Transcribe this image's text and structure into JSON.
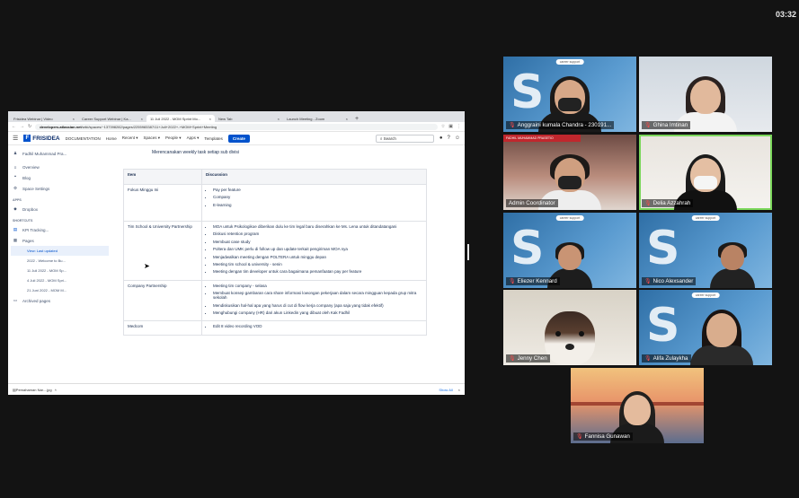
{
  "clock": "03:32",
  "browser": {
    "tabs": [
      {
        "title": "Frisidea Webinar | Video",
        "active": false
      },
      {
        "title": "Career Support Webinar | Ka...",
        "active": false
      },
      {
        "title": "11 Juli 2022 - MOM Sprint Mo...",
        "active": true
      },
      {
        "title": "New Tab",
        "active": false
      },
      {
        "title": "Launch Meeting - Zoom",
        "active": false
      }
    ],
    "url_host": "developers.atlassian.net",
    "url_path": "/wiki/spaces/~137398282/pages/2255983387/11+Juli+2022+-+MOM+Sprint+Meeting"
  },
  "confluence": {
    "logo": "FRISIDEA",
    "doc_label": "DOCUMENTATION",
    "nav": [
      "Home",
      "Recent ▾",
      "Spaces ▾",
      "People ▾",
      "Apps ▾",
      "Templates"
    ],
    "create_label": "Create",
    "search_placeholder": "Search"
  },
  "sidebar": {
    "user": "Fadhil Muhammad Pra...",
    "items": [
      "Overview",
      "Blog",
      "Space Settings"
    ],
    "apps_header": "APPS",
    "apps": [
      "Dropbox"
    ],
    "shortcuts_header": "SHORTCUTS",
    "shortcuts": [
      "KPI Tracking..."
    ],
    "pages_label": "Pages",
    "pages": [
      {
        "label": "View: Last updated",
        "highlight": true
      },
      {
        "label": "2022 - Welcome to Bu...",
        "highlight": false
      },
      {
        "label": "11 Juli 2022 - MOM Sp...",
        "highlight": false
      },
      {
        "label": "4 Juli 2022 - MOM Spri...",
        "highlight": false
      },
      {
        "label": "21 Juni 2022 - MOM M...",
        "highlight": false
      }
    ],
    "archived": "Archived pages"
  },
  "page": {
    "intro": "Merencanakan weekly task setiap sub divisi",
    "table_headers": [
      "Item",
      "Discussion"
    ],
    "rows": [
      {
        "item": "Fokus Minggu Ini",
        "points": [
          "Pay per feature",
          "Company",
          "E-learning"
        ]
      },
      {
        "item": "Tim School & University Partnership",
        "points": [
          "MOA untuk Psikologikoe diberikan dulu ke tim legal baru diserahkan ke Ms. Lena untuk ditandatangani",
          "Diskusi retention program",
          "Membuat case study",
          "Poltera dan UMK perlu di follow up dan update terkait pengiriman MOA nya",
          "Menjadwalkan meeting dengan POLTERA untuk minggu depan",
          "Meeting tim school & university - senin",
          "Meeting dengan tim developer untuk cara bagaimana pemanfaatan pay per feature"
        ]
      },
      {
        "item": "Company Partnership",
        "points": [
          "Meeting tim company - selasa",
          "Membuat konsep gambaran cara share informasi lowongan pekerjaan dalam secara mingguan kepada grup mitra sekolah",
          "Mendiskusikan hal-hal apa yang harus di cut di flow kerja company (apa saja yang tidak efektif)",
          "Menghubungi company (HR) dari akun Linkedin yang dibuat oleh Kak Fadhil"
        ]
      },
      {
        "item": "Medcom",
        "points": [
          "Edit 8 video recording VOD"
        ]
      }
    ]
  },
  "download_bar": {
    "file": "Pemahaman Nar....jpg",
    "show_all": "Show All"
  },
  "participants": [
    {
      "name": "Anggraini kumala Chandra - 230191...",
      "badge": "career support"
    },
    {
      "name": "Ghina Imtinan"
    },
    {
      "name": "Admin Coordinator",
      "banner": "FADHIL MUHAMMAD PRASETIO"
    },
    {
      "name": "Delia Azzahrah"
    },
    {
      "name": "Eliezer Kennard",
      "badge": "career support"
    },
    {
      "name": "Nico Alexsander",
      "badge": "career support"
    },
    {
      "name": "Jenny Chen"
    },
    {
      "name": "Alifa Zulaykha",
      "badge": "career support"
    },
    {
      "name": "Fannisa Gunawan"
    }
  ]
}
